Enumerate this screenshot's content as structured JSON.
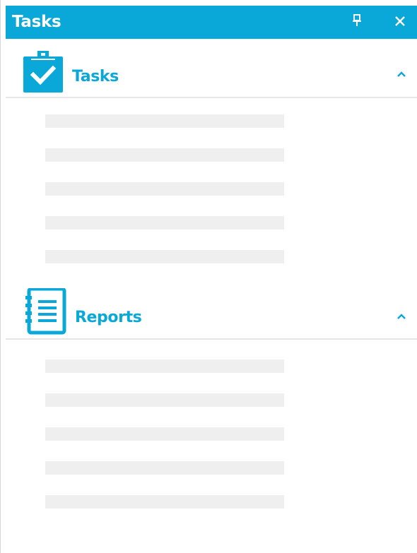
{
  "window": {
    "title": "Tasks",
    "pin_icon": "pin-icon",
    "close_icon": "close-icon",
    "accent": "#0aa8d8"
  },
  "sections": [
    {
      "key": "tasks",
      "title": "Tasks",
      "icon": "clipboard-check-icon",
      "expanded": true,
      "chevron_icon": "chevron-up-icon",
      "placeholder_rows": 5
    },
    {
      "key": "reports",
      "title": "Reports",
      "icon": "notebook-icon",
      "expanded": true,
      "chevron_icon": "chevron-up-icon",
      "placeholder_rows": 5
    }
  ]
}
